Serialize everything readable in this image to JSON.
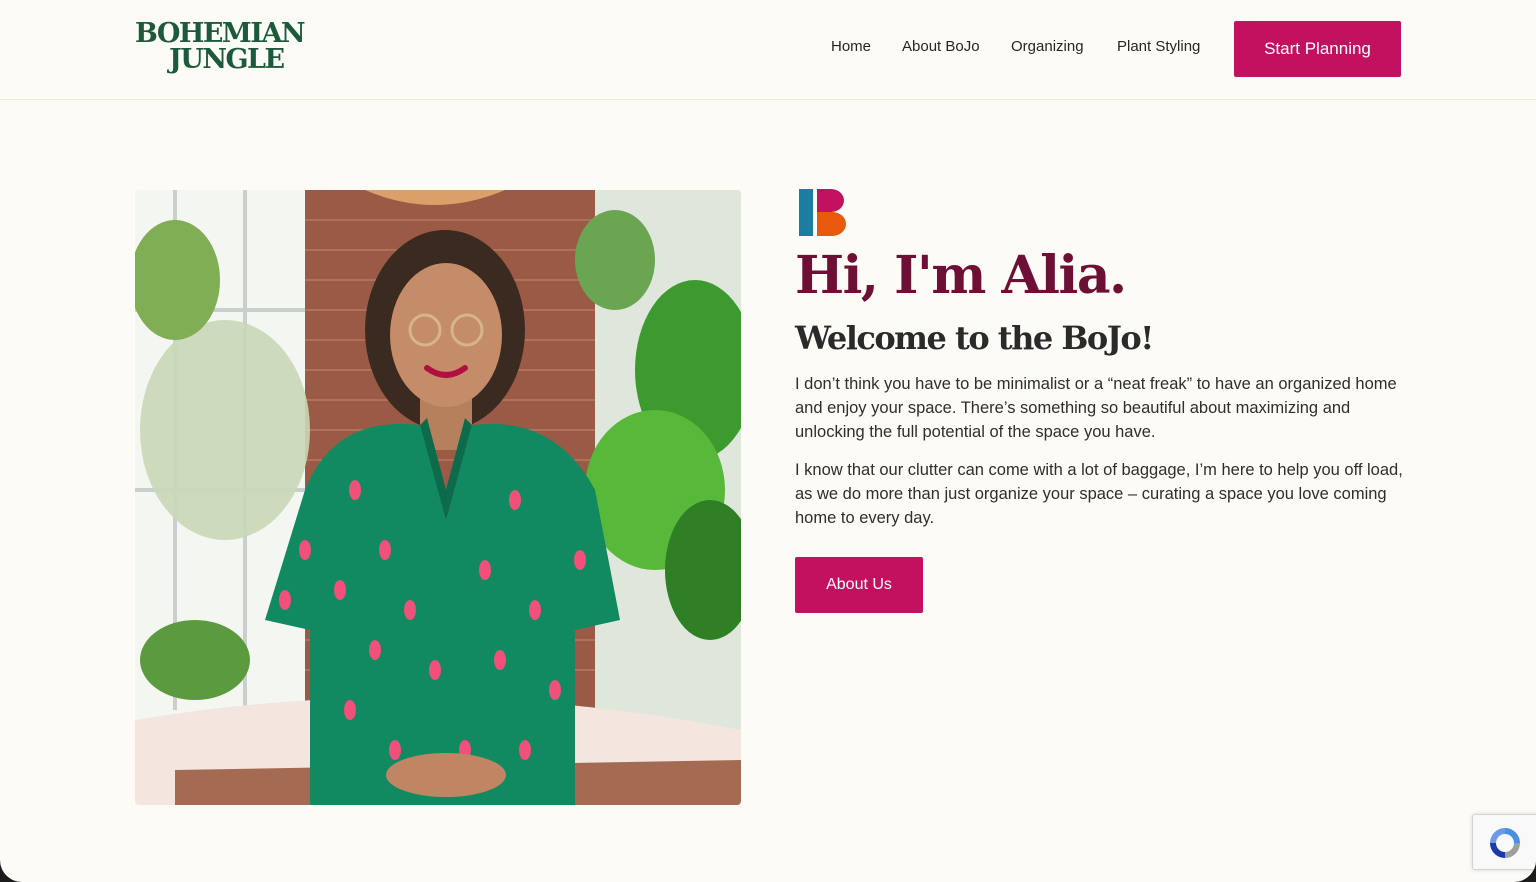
{
  "header": {
    "logo_line1": "BOHEMIAN",
    "logo_line2": "JUNGLE",
    "nav": [
      "Home",
      "About BoJo",
      "Organizing",
      "Plant Styling"
    ],
    "cta_label": "Start Planning"
  },
  "hero": {
    "heading": "Hi, I'm Alia.",
    "subheading": "Welcome to the BoJo!",
    "paragraph1": "I don’t think you have to be minimalist or a “neat freak” to have an organized home and enjoy your space. There’s something so beautiful about maximizing and unlocking the full potential of the space you have.",
    "paragraph2": "I know that our clutter can come with a lot of baggage, I’m here to help you off load, as we do more than just organize your space – curating a space you love coming home to every day.",
    "button_label": "About Us"
  },
  "colors": {
    "accent": "#c2125f",
    "heading": "#6e1035",
    "logo": "#1d5a3b",
    "mark_blue": "#1b7ea0",
    "mark_pink": "#c2125f",
    "mark_orange": "#e8590c"
  },
  "icons": {
    "brand_mark": "bojo-b-icon",
    "recaptcha": "recaptcha-icon"
  }
}
